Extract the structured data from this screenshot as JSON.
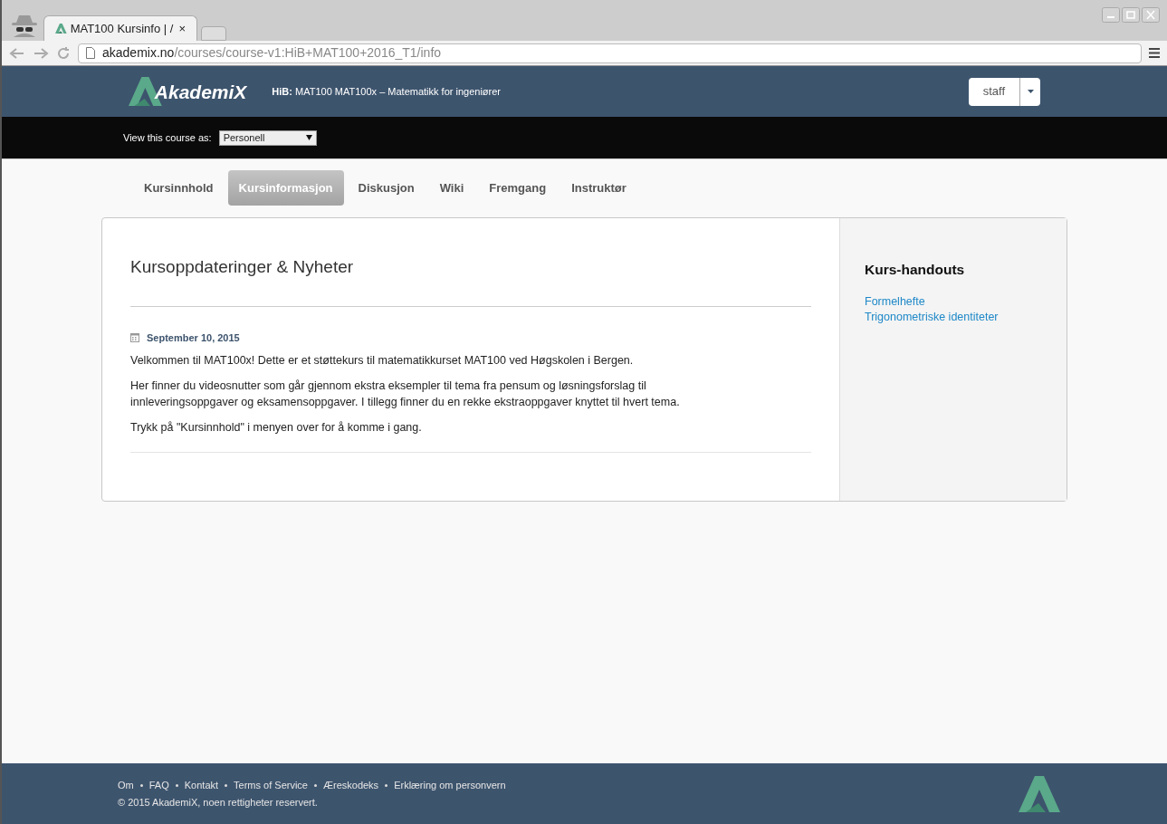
{
  "browser": {
    "tabs": [
      {
        "title": "MAT100 Kursinfo | /",
        "selected": true
      }
    ],
    "close_tab": "×",
    "url_host": "akademix.no",
    "url_path": "/courses/course-v1:HiB+MAT100+2016_T1/info"
  },
  "header": {
    "logo_text": "AkademiX",
    "course_org": "HiB:",
    "course_title": "MAT100 MAT100x – Matematikk for ingeniører",
    "user_button": "staff"
  },
  "staff_bar": {
    "label": "View this course as:",
    "role": "Personell"
  },
  "nav_tabs": [
    {
      "label": "Kursinnhold",
      "selected": false
    },
    {
      "label": "Kursinformasjon",
      "selected": true
    },
    {
      "label": "Diskusjon",
      "selected": false
    },
    {
      "label": "Wiki",
      "selected": false
    },
    {
      "label": "Fremgang",
      "selected": false
    },
    {
      "label": "Instruktør",
      "selected": false
    }
  ],
  "updates": {
    "title": "Kursoppdateringer & Nyheter",
    "date": "September 10, 2015",
    "paragraphs": [
      "Velkommen til MAT100x! Dette er et støttekurs til matematikkurset MAT100 ved Høgskolen i Bergen.",
      "Her finner du videosnutter som går gjennom ekstra eksempler til tema fra pensum og løsningsforslag til innleveringsoppgaver og eksamensoppgaver. I tillegg finner du en rekke ekstraoppgaver knyttet til hvert tema.",
      "Trykk på \"Kursinnhold\" i menyen over for å komme i gang."
    ]
  },
  "handouts": {
    "title": "Kurs-handouts",
    "links": [
      "Formelhefte",
      "Trigonometriske identiteter"
    ]
  },
  "footer": {
    "links": [
      "Om",
      "FAQ",
      "Kontakt",
      "Terms of Service",
      "Æreskodeks",
      "Erklæring om personvern"
    ],
    "copyright": "© 2015 AkademiX, noen rettigheter reservert."
  }
}
